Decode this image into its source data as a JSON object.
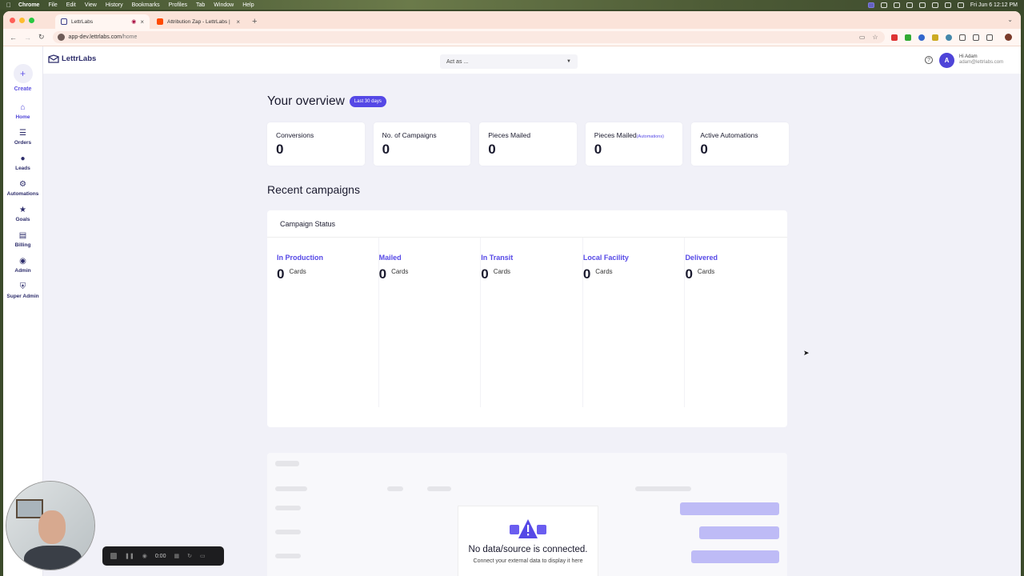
{
  "menubar": {
    "app": "Chrome",
    "items": [
      "File",
      "Edit",
      "View",
      "History",
      "Bookmarks",
      "Profiles",
      "Tab",
      "Window",
      "Help"
    ],
    "clock": "Fri Jun 6  12:12 PM"
  },
  "tabs": [
    {
      "title": "LettrLabs",
      "active": true
    },
    {
      "title": "Attribution Zap - LettrLabs |",
      "active": false
    }
  ],
  "address": {
    "domain": "app-dev.lettrlabs.com",
    "path": "/home"
  },
  "app": {
    "brand": "LettrLabs",
    "act_as": "Act as ...",
    "user_greeting": "Hi Adam",
    "user_email": "adam@lettrlabs.com",
    "avatar_initial": "A",
    "accent": "#5548e6"
  },
  "sidebar": {
    "create": "Create",
    "items": [
      {
        "label": "Home",
        "icon": "home-icon",
        "active": true
      },
      {
        "label": "Orders",
        "icon": "list-icon",
        "active": false
      },
      {
        "label": "Leads",
        "icon": "person-icon",
        "active": false
      },
      {
        "label": "Automations",
        "icon": "automation-icon",
        "active": false
      },
      {
        "label": "Goals",
        "icon": "star-icon",
        "active": false
      },
      {
        "label": "Billing",
        "icon": "card-icon",
        "active": false
      },
      {
        "label": "Admin",
        "icon": "admin-icon",
        "active": false
      },
      {
        "label": "Super Admin",
        "icon": "shield-icon",
        "active": false
      }
    ]
  },
  "overview": {
    "title": "Your overview",
    "range_badge": "Last 30 days",
    "stats": [
      {
        "label": "Conversions",
        "sub": "",
        "value": "0"
      },
      {
        "label": "No. of Campaigns",
        "sub": "",
        "value": "0"
      },
      {
        "label": "Pieces Mailed",
        "sub": "",
        "value": "0"
      },
      {
        "label": "Pieces Mailed",
        "sub": "(Automations)",
        "value": "0"
      },
      {
        "label": "Active Automations",
        "sub": "",
        "value": "0"
      }
    ]
  },
  "recent": {
    "title": "Recent campaigns",
    "status_title": "Campaign Status",
    "columns": [
      {
        "label": "In Production",
        "value": "0",
        "unit": "Cards"
      },
      {
        "label": "Mailed",
        "value": "0",
        "unit": "Cards"
      },
      {
        "label": "In Transit",
        "value": "0",
        "unit": "Cards"
      },
      {
        "label": "Local Facility",
        "value": "0",
        "unit": "Cards"
      },
      {
        "label": "Delivered",
        "value": "0",
        "unit": "Cards"
      }
    ]
  },
  "nodata": {
    "title": "No data/source is connected.",
    "subtitle": "Connect your external data to display it here"
  },
  "recorder": {
    "time": "0:00"
  }
}
